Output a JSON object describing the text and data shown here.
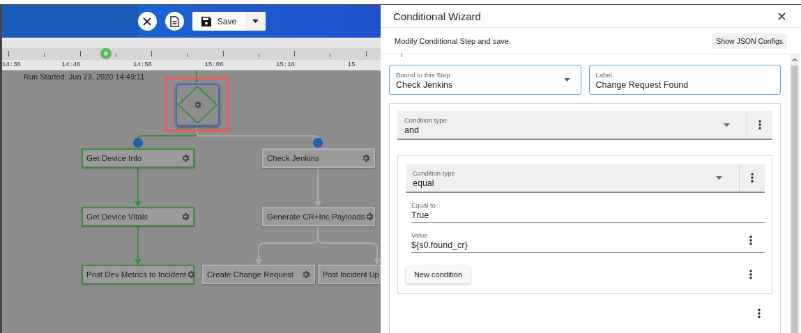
{
  "toolbar": {
    "save_label": "Save"
  },
  "timeline": {
    "ticks": [
      "14:36",
      "14:46",
      "14:56",
      "15:06",
      "15:16",
      "15"
    ]
  },
  "canvas": {
    "run_started": "Run Started: Jun 23, 2020 14:49:11",
    "condition_node": {
      "selected": true
    },
    "nodes": [
      {
        "label": "Get Device Info",
        "active": true
      },
      {
        "label": "Get Device Vitals",
        "active": true
      },
      {
        "label": "Post Dev Metrics to Incident",
        "active": true
      },
      {
        "label": "Check Jenkins",
        "active": false
      },
      {
        "label": "Generate CR+Inc Payloads",
        "active": false
      },
      {
        "label": "Create Change Request",
        "active": false
      },
      {
        "label": "Post Incident Up",
        "active": false
      }
    ]
  },
  "wizard": {
    "title": "Conditional Wizard",
    "subtitle": "Modify Conditional Step and save.",
    "show_json_button": "Show JSON Configs",
    "bound_step": {
      "label": "Bound to this Step",
      "value": "Check Jenkins"
    },
    "step_label": {
      "label": "Label",
      "value": "Change Request Found"
    },
    "condition_type": {
      "label": "Condition type",
      "value": "and"
    },
    "sub_condition": {
      "condition_type": {
        "label": "Condition type",
        "value": "equal"
      },
      "equal_to": {
        "label": "Equal to",
        "value": "True"
      },
      "value": {
        "label": "Value",
        "value": "${s0.found_cr}"
      },
      "new_condition_button": "New condition"
    }
  }
}
